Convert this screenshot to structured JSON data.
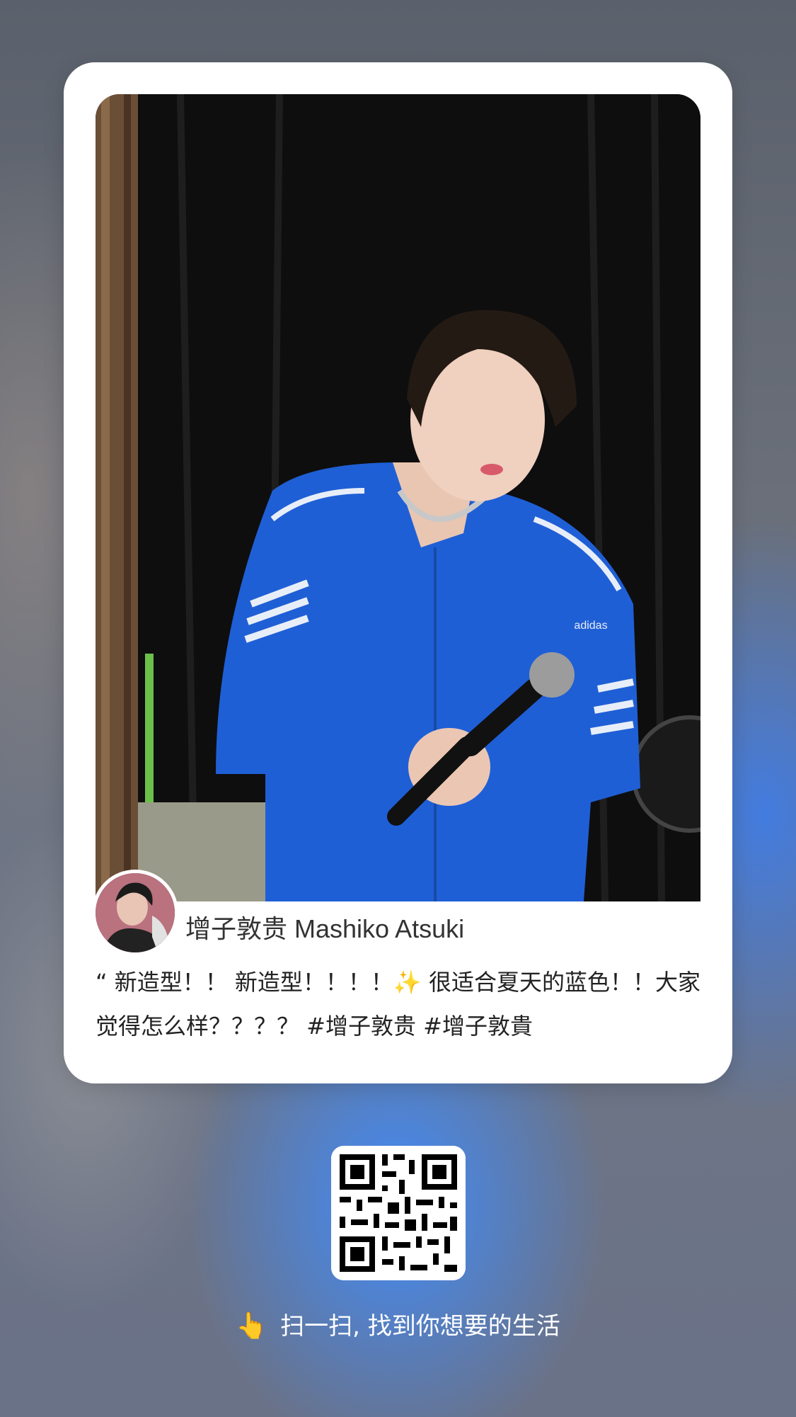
{
  "post": {
    "author": "增子敦贵 Mashiko Atsuki",
    "caption": "“ 新造型！！ 新造型！！！！✨ 很适合夏天的蓝色！！大家觉得怎么样？？？？ #增子敦贵  #增子敦貴",
    "photo_description": "man in blue adidas track jacket holding microphone"
  },
  "footer": {
    "pointer_icon": "👆",
    "scan_text": "扫一扫, 找到你想要的生活"
  },
  "icons": {
    "qr": "qr-code",
    "avatar": "avatar"
  },
  "colors": {
    "card_bg": "#ffffff",
    "jacket_blue": "#1f5fd6",
    "background_blue": "#3f8cff"
  }
}
